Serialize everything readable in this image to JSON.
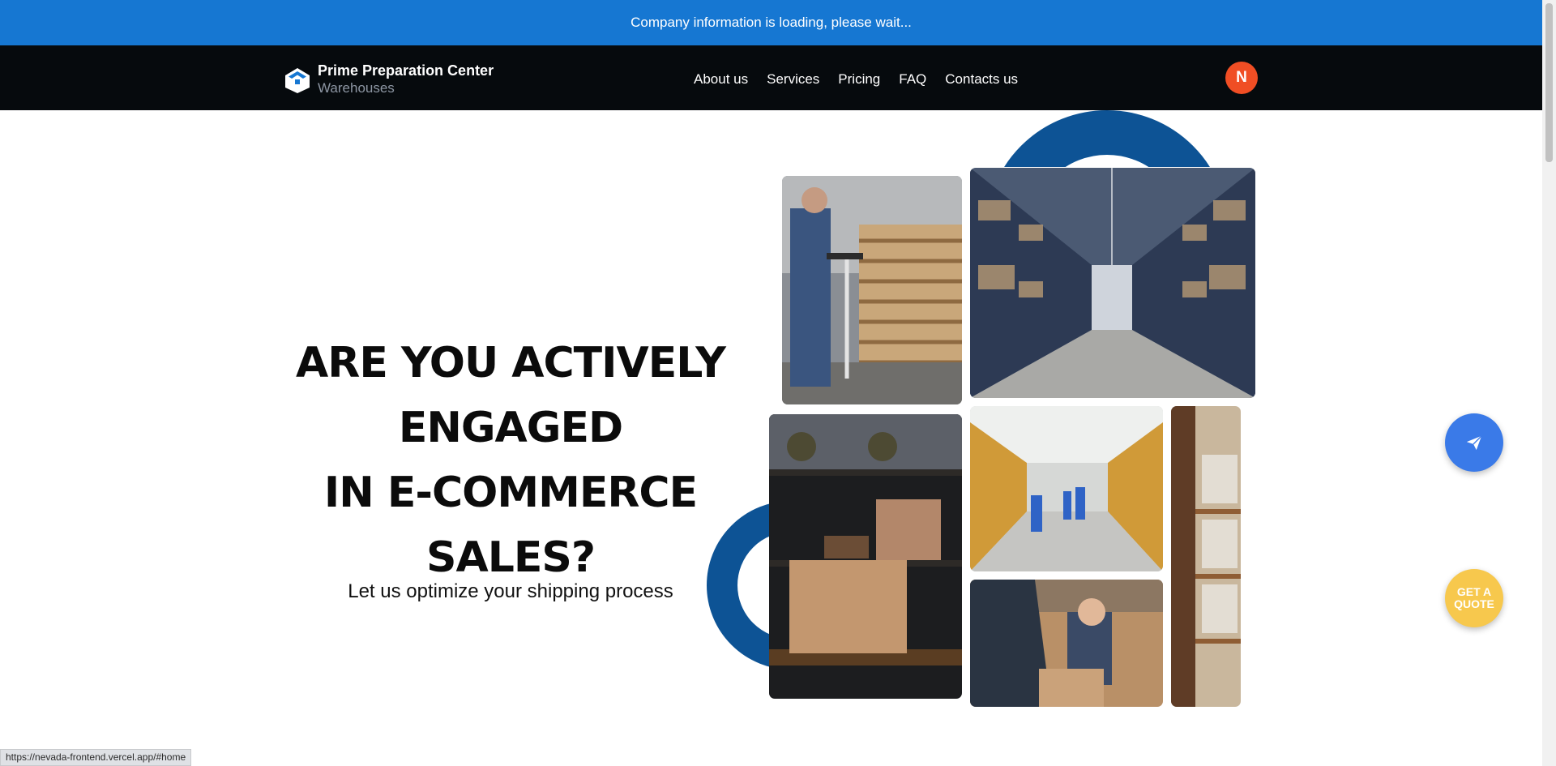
{
  "notice": {
    "text": "Company information is loading, please wait..."
  },
  "brand": {
    "title": "Prime Preparation Center",
    "subtitle": "Warehouses",
    "logo_icon": "house-box-icon"
  },
  "nav": {
    "items": [
      {
        "label": "About us"
      },
      {
        "label": "Services"
      },
      {
        "label": "Pricing"
      },
      {
        "label": "FAQ"
      },
      {
        "label": "Contacts us"
      }
    ]
  },
  "user": {
    "avatar_letter": "N",
    "avatar_color": "#f04e24"
  },
  "hero": {
    "title_lines": [
      "ARE YOU ACTIVELY",
      "ENGAGED",
      "IN E-COMMERCE",
      "SALES?"
    ],
    "subtitle": "Let us optimize your shipping process"
  },
  "photos": [
    {
      "name": "worker-at-laptop-photo"
    },
    {
      "name": "warehouse-aisle-photo"
    },
    {
      "name": "shelf-with-boxes-photo"
    },
    {
      "name": "warehouse-workers-photo"
    },
    {
      "name": "pallet-rack-photo"
    },
    {
      "name": "worker-loading-boxes-photo"
    }
  ],
  "actions": {
    "send_icon": "paper-plane-icon",
    "quote_label_line1": "GET A",
    "quote_label_line2": "QUOTE"
  },
  "status": {
    "url": "https://nevada-frontend.vercel.app/#home"
  },
  "colors": {
    "notice_bg": "#1677d2",
    "nav_bg": "#060a0d",
    "accent_blue": "#0d5395",
    "send_button": "#3a7ae8",
    "quote_button": "#f7c84d"
  }
}
